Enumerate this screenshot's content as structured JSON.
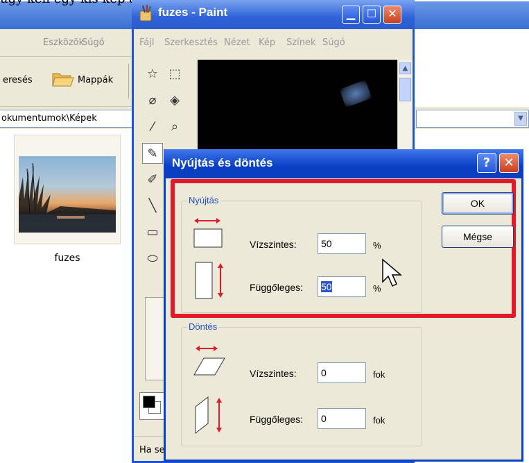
{
  "top_text": "ügy kell egy kis kép a rajzol, ez ámításai, éppen i",
  "explorer": {
    "menu": [
      "Eszközök",
      "Súgó"
    ],
    "toolbar": {
      "search_label": "eresés",
      "folders_label": "Mappák"
    },
    "address": "okumentumok\\Képek",
    "thumbnail_label": "fuzes"
  },
  "paint": {
    "title": "fuzes - Paint",
    "menu": [
      "Fájl",
      "Szerkesztés",
      "Nézet",
      "Kép",
      "Színek",
      "Súgó"
    ],
    "status": "Ha se"
  },
  "dialog": {
    "title": "Nyújtás és döntés",
    "help_label": "?",
    "close_label": "✕",
    "stretch": {
      "legend": "Nyújtás",
      "horizontal_label": "Vízszintes:",
      "horizontal_value": "50",
      "horizontal_unit": "%",
      "vertical_label": "Függőleges:",
      "vertical_value": "50",
      "vertical_unit": "%"
    },
    "skew": {
      "legend": "Döntés",
      "horizontal_label": "Vízszintes:",
      "horizontal_value": "0",
      "horizontal_unit": "fok",
      "vertical_label": "Függőleges:",
      "vertical_value": "0",
      "vertical_unit": "fok"
    },
    "ok_label": "OK",
    "cancel_label": "Mégse"
  },
  "colors": {
    "highlight": "#e11a2a",
    "titlebar_blue": "#0a3ec4",
    "legend_blue": "#1c4fc4",
    "arrow_red": "#e11a2a"
  }
}
